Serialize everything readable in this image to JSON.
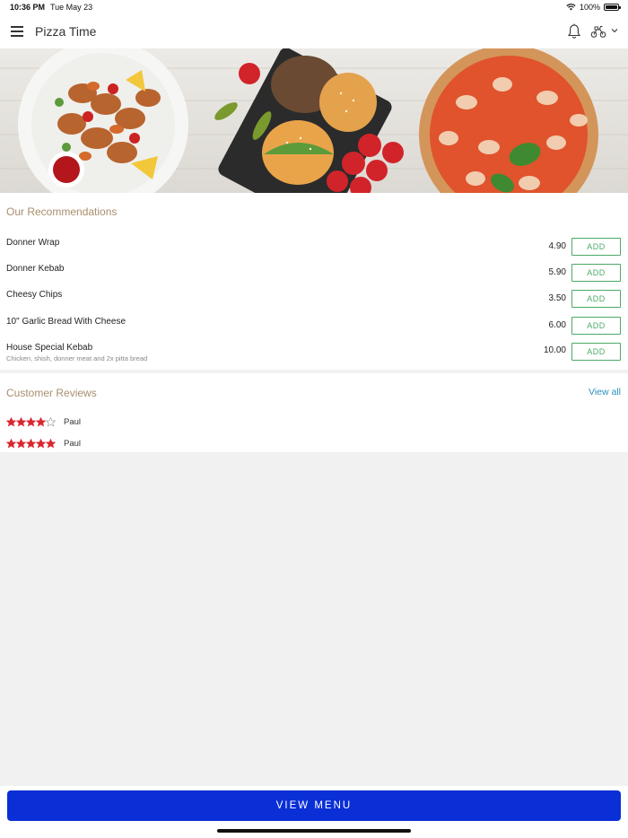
{
  "status_bar": {
    "time": "10:36 PM",
    "date": "Tue May 23",
    "battery": "100%"
  },
  "header": {
    "title": "Pizza Time",
    "icons": [
      "menu-icon",
      "bell-icon",
      "scooter-icon",
      "chevron-down-icon"
    ]
  },
  "recommendations": {
    "title": "Our Recommendations",
    "add_label": "ADD",
    "items": [
      {
        "name": "Donner Wrap",
        "description": "",
        "price": "4.90"
      },
      {
        "name": "Donner Kebab",
        "description": "",
        "price": "5.90"
      },
      {
        "name": "Cheesy Chips",
        "description": "",
        "price": "3.50"
      },
      {
        "name": "10\" Garlic Bread With Cheese",
        "description": "",
        "price": "6.00"
      },
      {
        "name": "House Special Kebab",
        "description": "Chicken, shish, donner meat and 2x pitta bread",
        "price": "10.00"
      }
    ]
  },
  "reviews": {
    "title": "Customer Reviews",
    "view_all": "View all",
    "items": [
      {
        "name": "Paul",
        "rating": 4,
        "max": 5
      },
      {
        "name": "Paul",
        "rating": 5,
        "max": 5
      }
    ]
  },
  "footer": {
    "button_label": "VIEW MENU"
  },
  "colors": {
    "accent_green": "#4caa68",
    "section_title": "#a98e6c",
    "link_blue": "#2a8fbd",
    "primary_button": "#0a2fd6",
    "star_red": "#d9272e"
  }
}
